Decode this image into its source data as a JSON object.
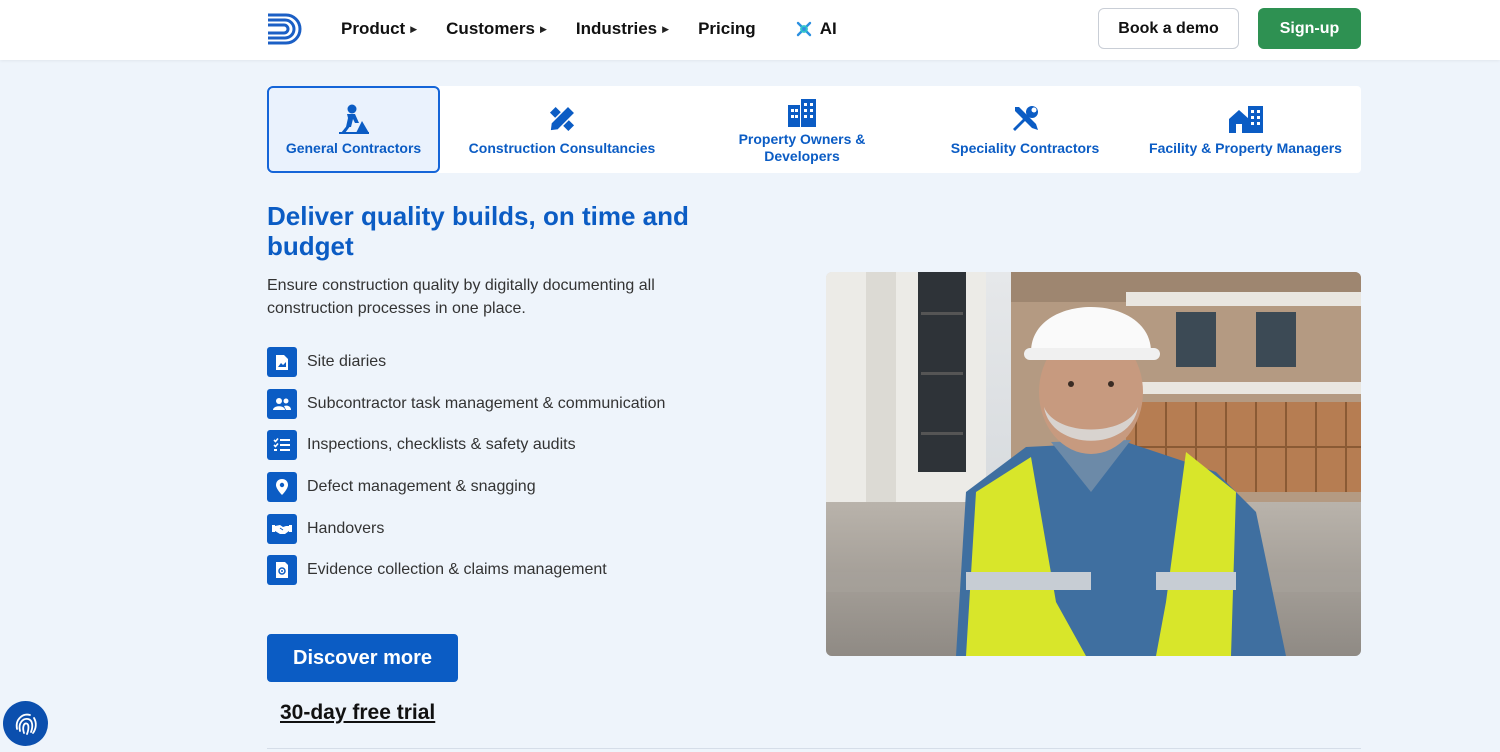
{
  "nav": {
    "items": [
      {
        "label": "Product",
        "has_caret": true
      },
      {
        "label": "Customers",
        "has_caret": true
      },
      {
        "label": "Industries",
        "has_caret": true
      },
      {
        "label": "Pricing",
        "has_caret": false
      }
    ],
    "ai_label": "AI",
    "book_demo": "Book a demo",
    "signup": "Sign-up"
  },
  "tabs": [
    {
      "label": "General Contractors",
      "icon": "worker-icon",
      "active": true
    },
    {
      "label": "Construction Consultancies",
      "icon": "pencil-ruler-icon",
      "active": false
    },
    {
      "label": "Property Owners & Developers",
      "icon": "buildings-icon",
      "active": false
    },
    {
      "label": "Speciality Contractors",
      "icon": "tools-icon",
      "active": false
    },
    {
      "label": "Facility & Property Managers",
      "icon": "house-building-icon",
      "active": false
    }
  ],
  "main": {
    "headline": "Deliver quality builds, on time and budget",
    "subtext": "Ensure construction quality by digitally documenting all construction processes in one place.",
    "features": [
      {
        "label": "Site diaries",
        "icon": "document-image-icon"
      },
      {
        "label": "Subcontractor task management & communication",
        "icon": "users-icon"
      },
      {
        "label": "Inspections, checklists & safety audits",
        "icon": "checklist-icon"
      },
      {
        "label": "Defect management & snagging",
        "icon": "location-pin-icon"
      },
      {
        "label": "Handovers",
        "icon": "handshake-icon"
      },
      {
        "label": "Evidence collection & claims management",
        "icon": "evidence-icon"
      }
    ],
    "discover_label": "Discover more",
    "trial_label": "30-day free trial"
  },
  "colors": {
    "brand_blue": "#0b5cc4",
    "signup_green": "#2e9152",
    "page_bg": "#eef4fb"
  }
}
